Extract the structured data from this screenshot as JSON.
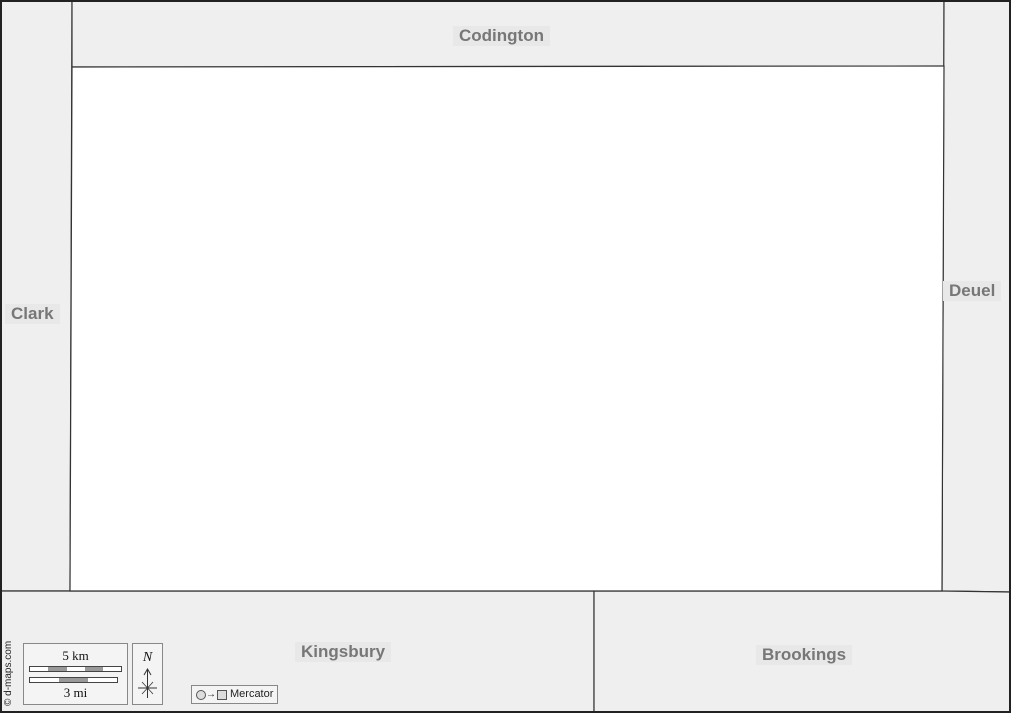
{
  "map": {
    "colors": {
      "focus_fill": "#ffffff",
      "neighbor_fill": "#efefef",
      "border": "#333333",
      "label_text": "#777777"
    },
    "counties": {
      "codington": "Codington",
      "clark": "Clark",
      "deuel": "Deuel",
      "kingsbury": "Kingsbury",
      "brookings": "Brookings"
    },
    "credit": "© d-maps.com",
    "scale": {
      "km_label": "5 km",
      "mi_label": "3 mi"
    },
    "north_label": "N",
    "projection_label": "Mercator"
  }
}
